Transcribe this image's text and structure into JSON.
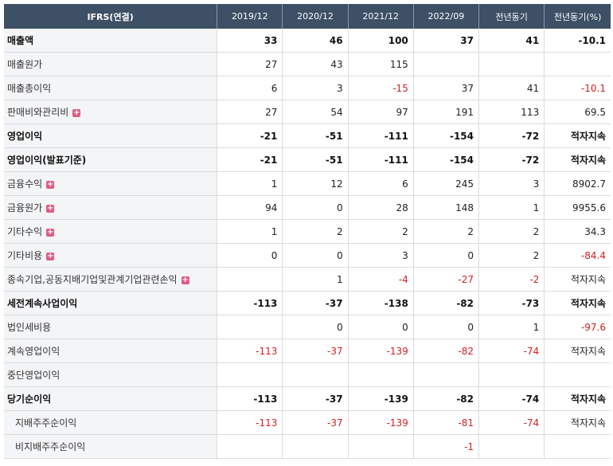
{
  "header": [
    "IFRS(연결)",
    "2019/12",
    "2020/12",
    "2021/12",
    "2022/09",
    "전년동기",
    "전년동기(%)"
  ],
  "rows": [
    {
      "label": "매출액",
      "bold": true,
      "expand": false,
      "indent": false,
      "values": [
        "33",
        "46",
        "100",
        "37",
        "41",
        "-10.1"
      ]
    },
    {
      "label": "매출원가",
      "bold": false,
      "expand": false,
      "indent": false,
      "values": [
        "27",
        "43",
        "115",
        "",
        "",
        ""
      ]
    },
    {
      "label": "매출총이익",
      "bold": false,
      "expand": false,
      "indent": false,
      "values": [
        "6",
        "3",
        "-15",
        "37",
        "41",
        "-10.1"
      ]
    },
    {
      "label": "판매비와관리비",
      "bold": false,
      "expand": true,
      "indent": false,
      "values": [
        "27",
        "54",
        "97",
        "191",
        "113",
        "69.5"
      ]
    },
    {
      "label": "영업이익",
      "bold": true,
      "expand": false,
      "indent": false,
      "values": [
        "-21",
        "-51",
        "-111",
        "-154",
        "-72",
        "적자지속"
      ]
    },
    {
      "label": "영업이익(발표기준)",
      "bold": true,
      "expand": false,
      "indent": false,
      "values": [
        "-21",
        "-51",
        "-111",
        "-154",
        "-72",
        "적자지속"
      ]
    },
    {
      "label": "금융수익",
      "bold": false,
      "expand": true,
      "indent": false,
      "values": [
        "1",
        "12",
        "6",
        "245",
        "3",
        "8902.7"
      ]
    },
    {
      "label": "금융원가",
      "bold": false,
      "expand": true,
      "indent": false,
      "values": [
        "94",
        "0",
        "28",
        "148",
        "1",
        "9955.6"
      ]
    },
    {
      "label": "기타수익",
      "bold": false,
      "expand": true,
      "indent": false,
      "values": [
        "1",
        "2",
        "2",
        "2",
        "2",
        "34.3"
      ]
    },
    {
      "label": "기타비용",
      "bold": false,
      "expand": true,
      "indent": false,
      "values": [
        "0",
        "0",
        "3",
        "0",
        "2",
        "-84.4"
      ]
    },
    {
      "label": "종속기업,공동지배기업및관계기업관련손익",
      "bold": false,
      "expand": true,
      "indent": false,
      "values": [
        "",
        "1",
        "-4",
        "-27",
        "-2",
        "적자지속"
      ]
    },
    {
      "label": "세전계속사업이익",
      "bold": true,
      "expand": false,
      "indent": false,
      "values": [
        "-113",
        "-37",
        "-138",
        "-82",
        "-73",
        "적자지속"
      ]
    },
    {
      "label": "법인세비용",
      "bold": false,
      "expand": false,
      "indent": false,
      "values": [
        "",
        "0",
        "0",
        "0",
        "1",
        "-97.6"
      ]
    },
    {
      "label": "계속영업이익",
      "bold": false,
      "expand": false,
      "indent": false,
      "values": [
        "-113",
        "-37",
        "-139",
        "-82",
        "-74",
        "적자지속"
      ]
    },
    {
      "label": "중단영업이익",
      "bold": false,
      "expand": false,
      "indent": false,
      "values": [
        "",
        "",
        "",
        "",
        "",
        ""
      ]
    },
    {
      "label": "당기순이익",
      "bold": true,
      "expand": false,
      "indent": false,
      "values": [
        "-113",
        "-37",
        "-139",
        "-82",
        "-74",
        "적자지속"
      ]
    },
    {
      "label": "지배주주순이익",
      "bold": false,
      "expand": false,
      "indent": true,
      "values": [
        "-113",
        "-37",
        "-139",
        "-81",
        "-74",
        "적자지속"
      ]
    },
    {
      "label": "비지배주주순이익",
      "bold": false,
      "expand": false,
      "indent": true,
      "values": [
        "",
        "",
        "",
        "-1",
        "",
        ""
      ]
    }
  ],
  "expand_icon": "plus-icon",
  "colors": {
    "header_bg": "#3d5065",
    "negative": "#d42020",
    "label_bg": "#f4f5f7",
    "expand": "#e05c84"
  }
}
